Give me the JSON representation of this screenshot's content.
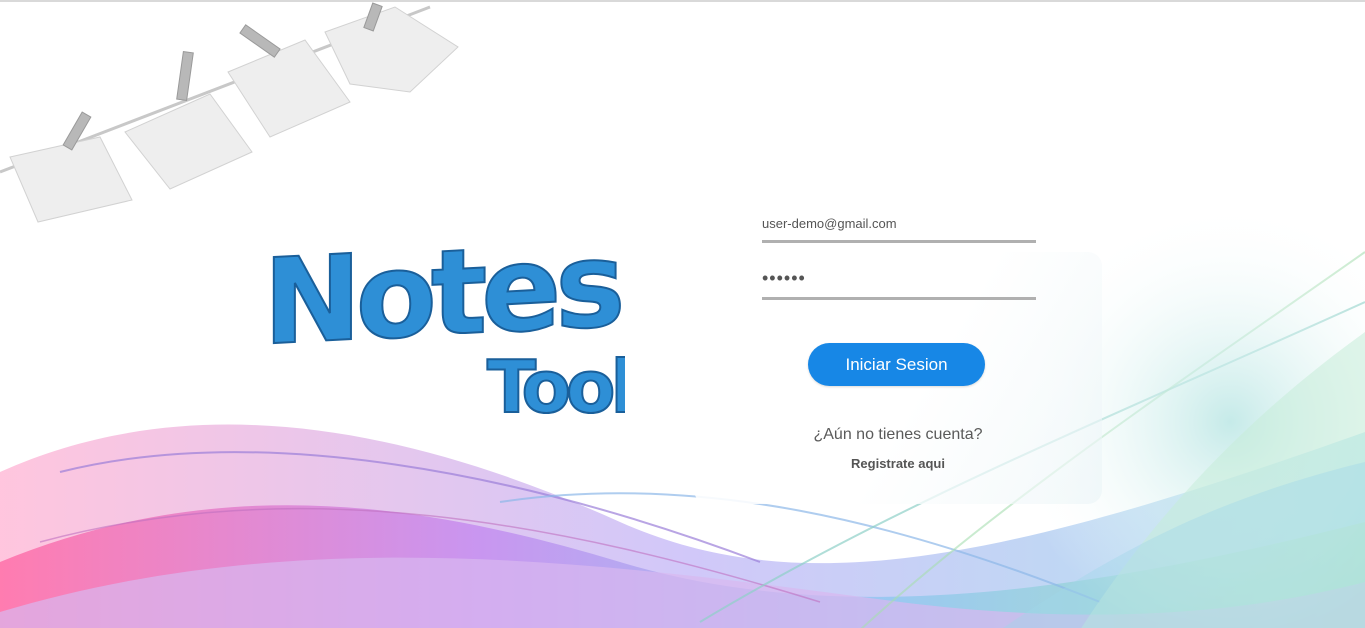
{
  "login": {
    "email_value": "user-demo@gmail.com",
    "password_value": "••••••",
    "submit_label": "Iniciar Sesion",
    "no_account_text": "¿Aún no tienes cuenta?",
    "register_link": "Registrate aqui"
  },
  "brand": {
    "logo_word_1": "Notes",
    "logo_word_2": "Tool"
  },
  "colors": {
    "primary_button": "#1787e6",
    "logo_blue": "#2e8fd6",
    "underline": "#b0b0b0"
  },
  "icons": [
    "clothesline-notes-illustration",
    "abstract-swirl-background"
  ]
}
